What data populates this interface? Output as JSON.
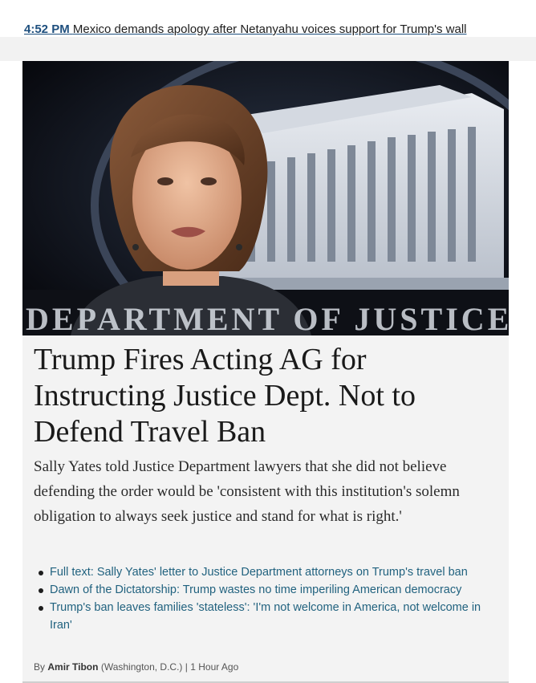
{
  "ticker": {
    "time": "4:52 PM",
    "headline": "Mexico demands apology after Netanyahu voices support for Trump's wall"
  },
  "hero": {
    "caption_overlay": "DEPARTMENT OF JUSTICE"
  },
  "article": {
    "title": "Trump Fires Acting AG for Instructing Justice Dept. Not to Defend Travel Ban",
    "summary": "Sally Yates told Justice Department lawyers that she did not believe defending the order would be 'consistent with this institution's solemn obligation to always seek justice and stand for what is right.'",
    "related_links": [
      "Full text: Sally Yates' letter to Justice Department attorneys on Trump's travel ban",
      "Dawn of the Dictatorship: Trump wastes no time imperiling American democracy",
      "Trump's ban leaves families 'stateless': 'I'm not welcome in America, not welcome in Iran'"
    ],
    "byline": {
      "prefix": "By",
      "author": "Amir Tibon",
      "location": "(Washington, D.C.)",
      "separator": "|",
      "time": "1 Hour Ago"
    }
  },
  "colors": {
    "link": "#21627f",
    "ticker_link": "#1e4f7e",
    "card_bg": "#f3f3f3"
  }
}
